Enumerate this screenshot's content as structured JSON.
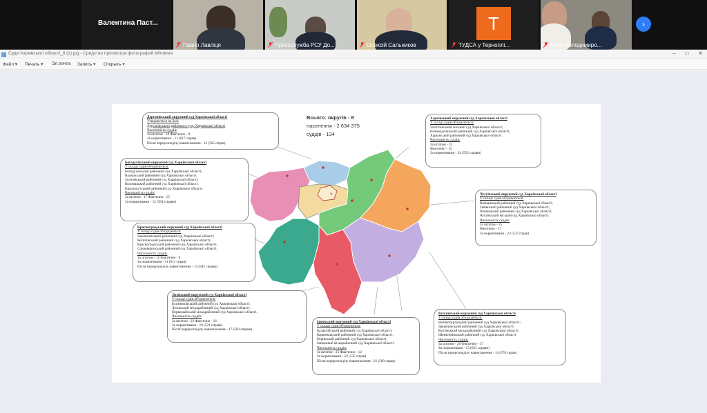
{
  "participants": [
    {
      "name": "Валентина  Паст..."
    },
    {
      "name": "Павло Лавліця"
    },
    {
      "name": "Прессслужба РСУ До..."
    },
    {
      "name": "Олексій Сальников"
    },
    {
      "name": "ТУДСА у Терноплі...",
      "avatar_letter": "Т"
    },
    {
      "name": "Юрій Володимиро..."
    }
  ],
  "window": {
    "title": "Суди Харківської області_8 (1).jpg - Средство просмотра фотографий Windows",
    "controls": [
      "–",
      "□",
      "✕"
    ]
  },
  "menu": [
    {
      "label": "Файл ▾"
    },
    {
      "label": "Печать ▾"
    },
    {
      "label": "Эл.почта"
    },
    {
      "label": "Запись ▾"
    },
    {
      "label": "Открыть ▾"
    }
  ],
  "slide": {
    "totals": {
      "districts": "Всього: округів - 8",
      "population": "населення - 2 634 375",
      "judges": "суддів - 134"
    },
    "callouts": [
      {
        "id": "derhachivskyi",
        "title": "Дергачівський окружний суд Харківської області",
        "lines": [
          "Утворюється на базі:",
          "Дергачівського районного суду Харківської області",
          "Чисельність суддів:",
          "За штатом - 10          Фактично - 9",
          "За нормативами - 11 (617 справ)",
          "Після перерозподілу навантаження - 12 (565 справ)"
        ]
      },
      {
        "id": "bohodukhivskyi",
        "title": "Богодухівський окружний суд Харківської області",
        "lines": [
          "У складі судів об'єднуються:",
          "Богодухівський районний суд Харківської області;",
          "Валківський районний суд Харківської області;",
          "Золочівський районний суд Харківської області;",
          "Коломацький районний суд Харківської області;",
          "Краснокутський районний суд Харківської області.",
          "Чисельність суддів:",
          "За штатом - 17           Фактично - 15",
          "За нормативами - 12 (564 справи)"
        ]
      },
      {
        "id": "krasnohradskyi",
        "title": "Красноградський окружний суд Харківської області",
        "lines": [
          "У складі судів об'єднуються:",
          "Зачепилівський районний суд Харківської області;",
          "Кегичівський районний суд Харківської області;",
          "Красноградський районний суд Харківської області;",
          "Сахновщинський районний суд Харківської області.",
          "Чисельність суддів:",
          "За штатом - 15          Фактично - 9",
          "За нормативами - 11 (611 справ)",
          "Після перерозподілу навантаження - 12 (582 справи)"
        ]
      },
      {
        "id": "lozivskyi",
        "title": "Лозівський окружний суд Харківської області",
        "lines": [
          "У складі судів об'єднуються:",
          "Близнюківський районний суд Харківської області;",
          "Лозівський міськрайонний суд Харківської області;",
          "Первомайський міськрайонний суд Харківської області.",
          "Чисельність суддів:",
          "За штатом - 22           Фактично - 16",
          "За нормативами - 19 (521 справа)",
          "Після перерозподілу навантаження - 17 (583 справи)"
        ]
      },
      {
        "id": "iziumskyi",
        "title": "Ізюмський окружний суд Харківської області",
        "lines": [
          "У складі судів об'єднуються:",
          "Балаклійський районний суд Харківської області;",
          "Барвінківський районний суд Харківської області;",
          "Борівський районний суд Харківської області;",
          "Ізюмський міськрайонний суд Харківської області.",
          "Чисельність суддів:",
          "За штатом - 25          Фактично - 12",
          "За нормативами - 22 (535 справ)",
          "Після перерозподілу навантаження - 21 (560 справ)"
        ]
      },
      {
        "id": "kupianskyi",
        "title": "Куп'янський окружний суд Харківської області",
        "lines": [
          "У складі судів об'єднуються:",
          "Великобурлуцький районний суд Харківської області;",
          "Дворічанський районний суд Харківської області;",
          "Куп'янський міськрайонний суд Харківської області;",
          "Шевченківський районний суд Харківської області.",
          "Чисельність суддів:",
          "За штатом - 20           Фактично - 17",
          "За нормативами - 13 (623 справи)",
          "Після перерозподілу навантаження - 14 (578 справ)"
        ]
      },
      {
        "id": "chuhuivskyi",
        "title": "Чугуївський окружний суд Харківської області",
        "lines": [
          "У складі судів об'єднуються:",
          "Вовчанський районний суд Харківської області;",
          "Зміївський районний суд Харківської області;",
          "Печенізький районний суд Харківської області;",
          "Чугуївський міський суд Харківської області.",
          "Чисельність суддів:",
          "За штатом - 25",
          "Фактично - 17",
          "За нормативами - 22 (537 справ)"
        ]
      },
      {
        "id": "kharkivskyi",
        "title": "Харківський окружний суд Харківської області",
        "lines": [
          "У складі судів об'єднуються:",
          "Золотоніський міський суд Харківської області;",
          "Нововодолазький районний суд Харківської області;",
          "Харківський районний суд Харківської області.",
          "Чисельність суддів:",
          "За штатом - 23",
          "Фактично - 15",
          "За нормативами - 24 (553 справи)"
        ]
      }
    ],
    "map_colors": {
      "derhachivskyi": "#a9cde8",
      "bohodukhivskyi": "#e88fb6",
      "kharkiv_city": "#f3dba0",
      "kharkivskyi": "#74c97a",
      "chuhuivskyi": "#f3a65c",
      "krasnohradskyi": "#3aa98e",
      "lozivskyi": "#e85a66",
      "iziumskyi": "#c2aee0",
      "kupianskyi": "#c2aee0"
    }
  }
}
